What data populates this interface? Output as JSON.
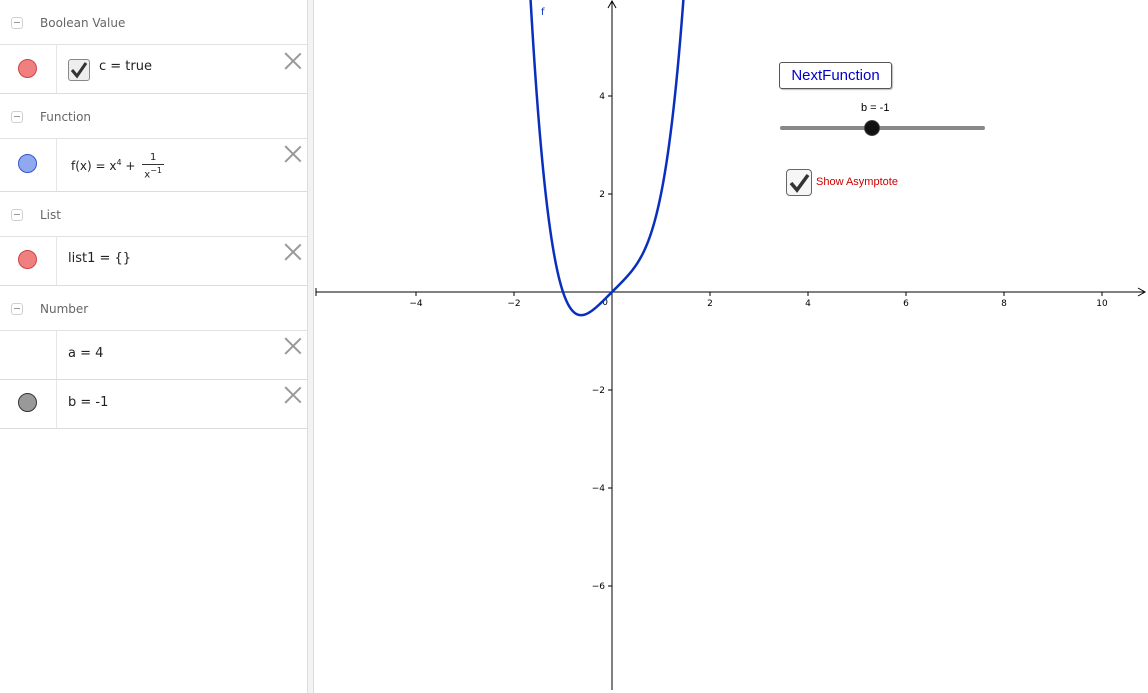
{
  "algebra": {
    "groups": [
      {
        "label": "Boolean Value"
      },
      {
        "label": "Function"
      },
      {
        "label": "List"
      },
      {
        "label": "Number"
      }
    ],
    "items": {
      "c": {
        "text": "c = true",
        "color": "#f08080"
      },
      "f": {
        "prefix": "f(x) = x",
        "exp": "4",
        "plus": "+",
        "num": "1",
        "den_base": "x",
        "den_exp": "−1",
        "color": "#8fa8f0"
      },
      "list1": {
        "text": "list1 = {}",
        "color": "#f08080"
      },
      "a": {
        "text": "a = 4"
      },
      "b": {
        "text": "b = -1",
        "color": "#999999"
      }
    }
  },
  "graphics": {
    "button_label": "NextFunction",
    "slider_label": "b = -1",
    "slider_value": -1,
    "checkbox_label": "Show Asymptote",
    "checkbox_checked": true,
    "curve_label": "f",
    "curve_color": "#0a2fbf"
  },
  "chart_data": {
    "type": "line",
    "title": "",
    "xlabel": "",
    "ylabel": "",
    "xlim": [
      -6.1,
      10.9
    ],
    "ylim": [
      -8.0,
      5.9
    ],
    "x_ticks": [
      -4,
      -2,
      2,
      4,
      6,
      8,
      10
    ],
    "y_ticks": [
      -6,
      -4,
      -2,
      2,
      4
    ],
    "origin_label": "0",
    "series": [
      {
        "name": "f",
        "expression": "x^4 + 1/x^(-1)"
      }
    ],
    "grid": false
  }
}
